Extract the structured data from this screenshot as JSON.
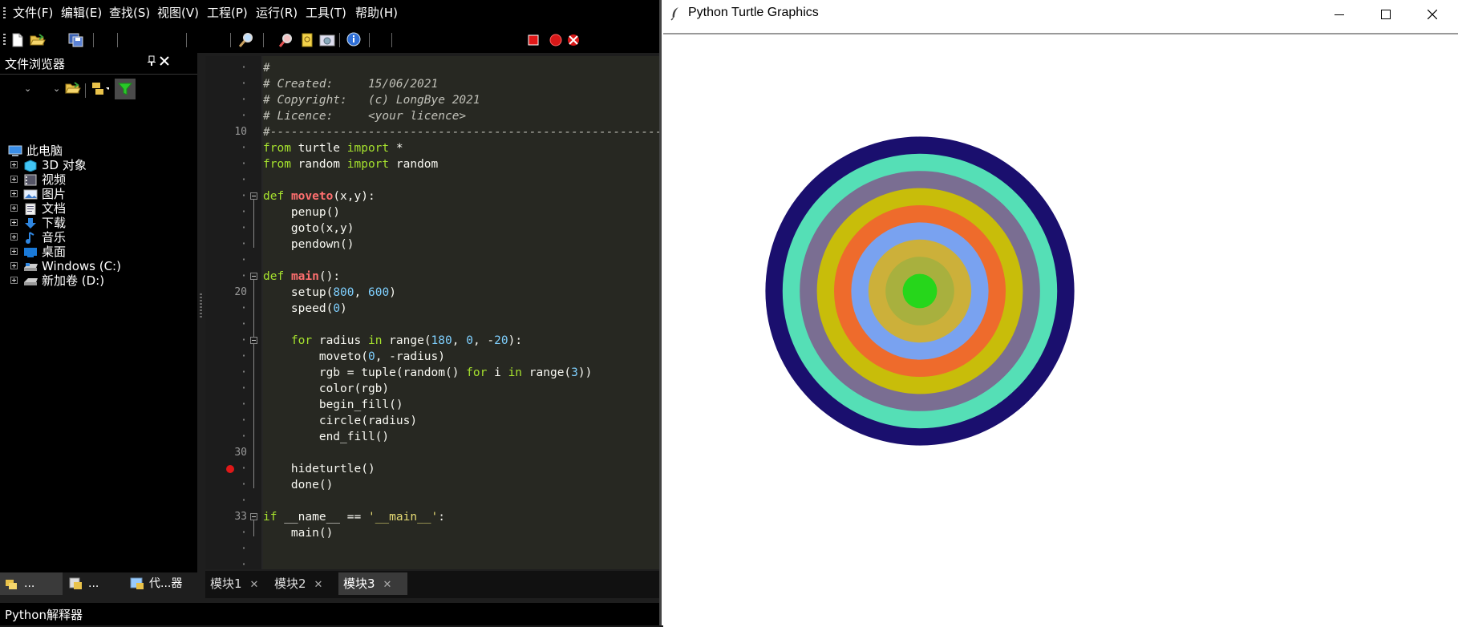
{
  "ide": {
    "menu": [
      "文件(F)",
      "编辑(E)",
      "查找(S)",
      "视图(V)",
      "工程(P)",
      "运行(R)",
      "工具(T)",
      "帮助(H)"
    ],
    "file_browser": {
      "title": "文件浏览器",
      "pin_icon": "pin-icon",
      "close_icon": "close-icon",
      "tree": [
        {
          "label": "此电脑",
          "icon": "computer-icon",
          "level": 0
        },
        {
          "label": "3D 对象",
          "icon": "3d-objects-icon",
          "level": 1
        },
        {
          "label": "视频",
          "icon": "video-icon",
          "level": 1
        },
        {
          "label": "图片",
          "icon": "pictures-icon",
          "level": 1
        },
        {
          "label": "文档",
          "icon": "documents-icon",
          "level": 1
        },
        {
          "label": "下载",
          "icon": "download-icon",
          "level": 1
        },
        {
          "label": "音乐",
          "icon": "music-icon",
          "level": 1
        },
        {
          "label": "桌面",
          "icon": "desktop-icon",
          "level": 1
        },
        {
          "label": "Windows (C:)",
          "icon": "drive-icon",
          "level": 1
        },
        {
          "label": "新加卷 (D:)",
          "icon": "drive-icon",
          "level": 1
        }
      ],
      "bottom_tabs": [
        "...",
        "...",
        "代...器"
      ]
    },
    "editor": {
      "line_numbers": [
        "·",
        "·",
        "·",
        "·",
        "10",
        "·",
        "·",
        "·",
        "·",
        "·",
        "·",
        "·",
        "·",
        "·",
        "20",
        "·",
        "·",
        "·",
        "·",
        "·",
        "·",
        "·",
        "·",
        "·",
        "30",
        "·",
        "·",
        "·",
        "33",
        "·",
        "·",
        "·"
      ],
      "lines": [
        "#",
        "# Created:     15/06/2021",
        "# Copyright:   (c) LongBye 2021",
        "# Licence:     <your licence>",
        "#-----------------------------------------------------------",
        "from turtle import *",
        "from random import random",
        "",
        "def moveto(x,y):",
        "    penup()",
        "    goto(x,y)",
        "    pendown()",
        "",
        "def main():",
        "    setup(800, 600)",
        "    speed(0)",
        "",
        "    for radius in range(180, 0, -20):",
        "        moveto(0, -radius)",
        "        rgb = tuple(random() for i in range(3))",
        "        color(rgb)",
        "        begin_fill()",
        "        circle(radius)",
        "        end_fill()",
        "",
        "    hideturtle()",
        "    done()",
        "",
        "if __name__ == '__main__':",
        "    main()"
      ],
      "tabs": [
        "模块1",
        "模块2",
        "模块3"
      ],
      "active_tab": "模块3"
    },
    "status": "Python解释器"
  },
  "turtle_window": {
    "title": "Python Turtle Graphics",
    "feather_icon": "feather-icon",
    "controls": [
      "minimize-icon",
      "maximize-icon",
      "close-icon"
    ],
    "ring_radii": [
      180,
      160,
      140,
      120,
      100,
      80,
      60,
      40,
      20
    ],
    "ring_colors": [
      "#1a0f6e",
      "#55dfb6",
      "#7a6e92",
      "#c8bd0a",
      "#ee6b2c",
      "#79a2f0",
      "#ccb03a",
      "#a8b03e",
      "#26d61b"
    ]
  }
}
